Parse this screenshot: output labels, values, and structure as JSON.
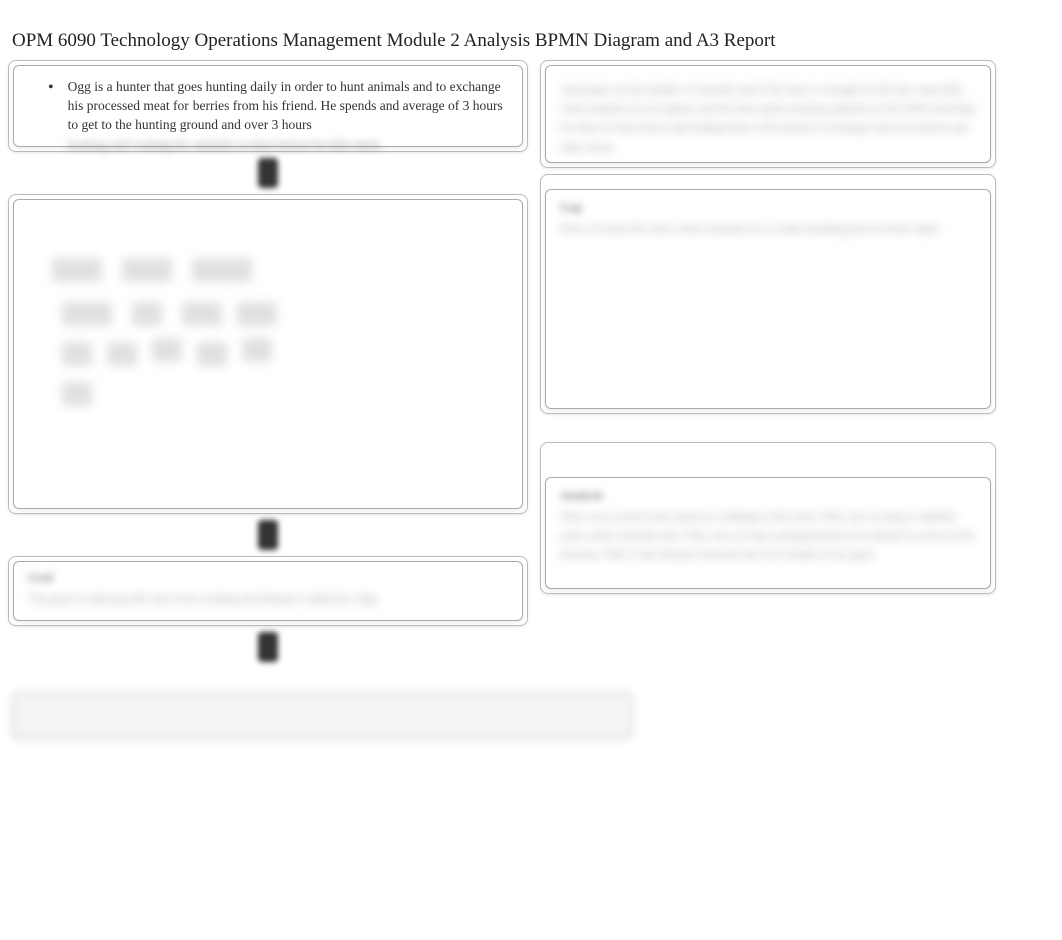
{
  "title": "OPM 6090 Technology Operations Management Module 2 Analysis BPMN Diagram and A3 Report",
  "box1": {
    "bullet": "•",
    "line1": "Ogg is a hunter that goes hunting daily in order to hunt animals and to exchange his processed meat for",
    "line2": "berries from his friend. He spends and average of 3 hours to get to the hunting ground and over 3 hours",
    "blurred_line": "looking and waiting for animals to hunt before he kills them"
  },
  "goal_box": {
    "label": "Goal",
    "blurred": "The goal is reducing idle time from waiting and distance walked by Ogg"
  },
  "right1": {
    "blurred": "Anticipate on the number of animals and if the hunt is enough for the day especially when animals do not appear and the time spent tracking animals on the field searching for them to hunt down and finding them with friend to exchange meat for berries and other items"
  },
  "right2": {
    "label": "Gap",
    "blurred": "How to locate the areas where animals are to make hunting process more rapid"
  },
  "right3": {
    "label": "Analysis",
    "blurred_items": "Why was so much time spent on walking to the areas. Why was so long to identify areas where animals stay. Why was so long waiting duration for animal to arrive at the location. Why is the distance between the two friends so far apart"
  }
}
